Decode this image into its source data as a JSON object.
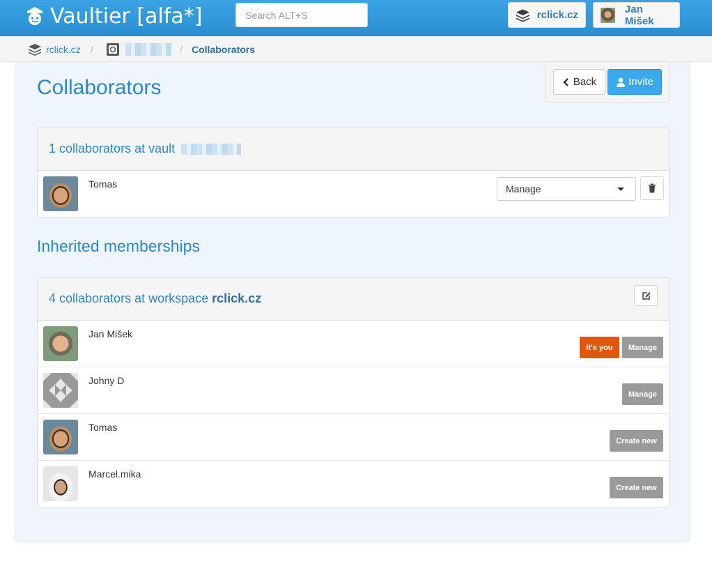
{
  "app": {
    "title": "Vaultier [alfa*]"
  },
  "search": {
    "placeholder": "Search ALT+S"
  },
  "navbar": {
    "workspace": "rclick.cz",
    "user": "Jan Mišek"
  },
  "breadcrumb": {
    "workspace": "rclick.cz",
    "separator": "/",
    "current": "Collaborators"
  },
  "page": {
    "title": "Collaborators",
    "back_label": "Back",
    "invite_label": "Invite"
  },
  "vault_panel": {
    "header": "1 collaborators at vault",
    "rows": [
      {
        "name": "Tomas",
        "role": "Manage"
      }
    ]
  },
  "inherited": {
    "title": "Inherited memberships",
    "header_prefix": "4 collaborators at workspace",
    "workspace": "rclick.cz",
    "rows": [
      {
        "name": "Jan Mišek",
        "you": "It's you",
        "badge": "Manage"
      },
      {
        "name": "Johny D",
        "badge": "Manage"
      },
      {
        "name": "Tomas",
        "badge": "Create new"
      },
      {
        "name": "Marcel.mika",
        "badge": "Create new"
      }
    ]
  },
  "colors": {
    "accent": "#2a8fd2",
    "you": "#e0580c",
    "badge": "#9a9a9a"
  }
}
